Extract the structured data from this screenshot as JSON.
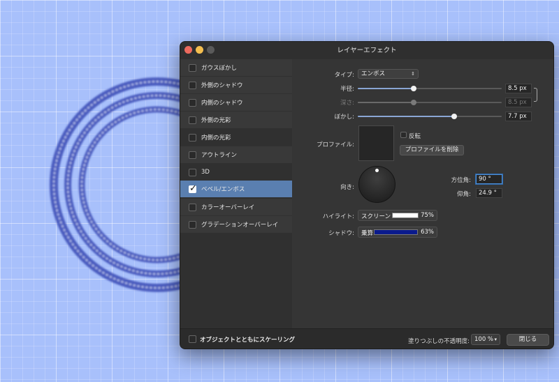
{
  "window": {
    "title": "レイヤーエフェクト"
  },
  "sidebar": {
    "items": [
      {
        "label": "ガウスぼかし",
        "checked": false
      },
      {
        "label": "外側のシャドウ",
        "checked": false
      },
      {
        "label": "内側のシャドウ",
        "checked": false
      },
      {
        "label": "外側の光彩",
        "checked": false
      },
      {
        "label": "内側の光彩",
        "checked": false
      },
      {
        "label": "アウトライン",
        "checked": false
      },
      {
        "label": "3D",
        "checked": false
      },
      {
        "label": "ベベル/エンボス",
        "checked": true,
        "selected": true
      },
      {
        "label": "カラーオーバーレイ",
        "checked": false
      },
      {
        "label": "グラデーションオーバーレイ",
        "checked": false
      }
    ]
  },
  "bevel": {
    "type_label": "タイプ:",
    "type_value": "エンボス",
    "radius_label": "半径:",
    "radius_value": "8.5 px",
    "radius_fraction": 0.39,
    "depth_label": "深さ:",
    "depth_value": "8.5 px",
    "depth_fraction": 0.39,
    "blur_label": "ぼかし:",
    "blur_value": "7.7 px",
    "blur_fraction": 0.67,
    "profile_label": "プロファイル:",
    "invert_label": "反転",
    "invert_checked": false,
    "delete_profile_label": "プロファイルを削除",
    "direction_label": "向き:",
    "azimuth_label": "方位角:",
    "azimuth_value": "90 °",
    "elevation_label": "仰角:",
    "elevation_value": "24.9 °",
    "highlight_label": "ハイライト:",
    "highlight_mode": "スクリーン",
    "highlight_color": "#ffffff",
    "highlight_opacity": "75%",
    "shadow_label": "シャドウ:",
    "shadow_mode": "乗算",
    "shadow_color": "#0a1a8c",
    "shadow_opacity": "63%"
  },
  "footer": {
    "scale_label": "オブジェクトとともにスケーリング",
    "scale_checked": false,
    "opacity_label": "塗りつぶしの不透明度:",
    "opacity_value": "100 %",
    "close_label": "閉じる"
  },
  "colors": {
    "canvas_bg": "#a8c0fb",
    "ring_color": "#2a3aa6",
    "accent": "#5a7fb0"
  }
}
